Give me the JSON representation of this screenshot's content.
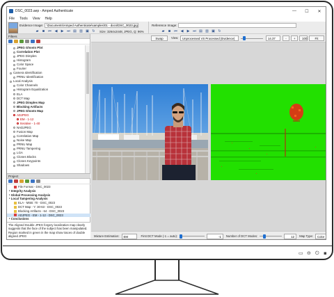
{
  "window": {
    "title": "DSC_0023.aep - Amped Authenticate",
    "minimize": "—",
    "maximize": "☐",
    "close": "✕"
  },
  "menu": [
    "File",
    "Tools",
    "View",
    "Help"
  ],
  "imagebar": {
    "evidence_label": "Evidence Image:",
    "evidence_path": "\\Documents\\Amped Authenticate\\samples\\01 - docs\\DSC_0023.jpg",
    "size_info": "Size: 3264x2448, JPEG, Q: 96%",
    "reference_label": "Reference Image:"
  },
  "filters": {
    "header": "Filters",
    "items": [
      {
        "label": "JPEG Ghosts Plot",
        "style": "bold",
        "indent": 1
      },
      {
        "label": "Correlation Plot",
        "style": "bold",
        "indent": 1
      },
      {
        "label": "JPEG Dimples",
        "style": "normal",
        "indent": 1
      },
      {
        "label": "Histogram",
        "style": "normal",
        "indent": 1
      },
      {
        "label": "Color Space",
        "style": "normal",
        "indent": 1
      },
      {
        "label": "Fourier",
        "style": "normal",
        "indent": 1
      },
      {
        "label": "Camera Identification",
        "style": "normal",
        "indent": 0
      },
      {
        "label": "PRNU Identification",
        "style": "normal",
        "indent": 1
      },
      {
        "label": "Local Analysis",
        "style": "normal",
        "indent": 0
      },
      {
        "label": "Color Channels",
        "style": "normal",
        "indent": 1
      },
      {
        "label": "Histogram Equalization",
        "style": "normal",
        "indent": 1
      },
      {
        "label": "ELA",
        "style": "normal",
        "indent": 1
      },
      {
        "label": "DCT Map",
        "style": "normal",
        "indent": 1
      },
      {
        "label": "JPEG Dimples Map",
        "style": "bold",
        "indent": 1
      },
      {
        "label": "Blocking Artifacts",
        "style": "bold",
        "indent": 1
      },
      {
        "label": "JPEG Ghosts Map",
        "style": "bold",
        "indent": 1
      },
      {
        "label": "ADJPEG",
        "style": "red",
        "indent": 1
      },
      {
        "label": "EM - 1-12",
        "style": "red",
        "indent": 2
      },
      {
        "label": "Iterative - 1-40",
        "style": "red",
        "indent": 2
      },
      {
        "label": "NADJPEG",
        "style": "normal",
        "indent": 1
      },
      {
        "label": "Fusion Map",
        "style": "normal",
        "indent": 1
      },
      {
        "label": "Correlation Map",
        "style": "normal",
        "indent": 1
      },
      {
        "label": "Noise Map",
        "style": "normal",
        "indent": 1
      },
      {
        "label": "PRNU Map",
        "style": "normal",
        "indent": 1
      },
      {
        "label": "PRNU Tampering",
        "style": "normal",
        "indent": 1
      },
      {
        "label": "LGA",
        "style": "normal",
        "indent": 1
      },
      {
        "label": "Clones Blocks",
        "style": "normal",
        "indent": 1
      },
      {
        "label": "Clones Keypoints",
        "style": "normal",
        "indent": 1
      },
      {
        "label": "Shadows",
        "style": "normal",
        "indent": 1
      }
    ]
  },
  "project": {
    "header": "Project",
    "items": [
      {
        "label": "File Format - DSC_0023",
        "indent": 1,
        "color": "#d94040"
      },
      {
        "label": "Integrity Analysis",
        "indent": 0,
        "bold": true
      },
      {
        "label": "Global Processing Analysis",
        "indent": 0,
        "bold": true
      },
      {
        "label": "Local Tampering Analysis",
        "indent": 0,
        "bold": true
      },
      {
        "label": "ELA - MSB: 70 - DSC_0023",
        "indent": 1,
        "color": "#e8c040"
      },
      {
        "label": "DCT Map - Y: 30-63 - DSC_0023",
        "indent": 1,
        "color": "#e8c040"
      },
      {
        "label": "Blocking Artifacts - 64 - DSC_0023",
        "indent": 1,
        "color": "#e8c040"
      },
      {
        "label": "ADJPEG - EM - 1-12 - DSC_0023",
        "indent": 1,
        "color": "#d94040",
        "selected": true
      },
      {
        "label": "Conclusions",
        "indent": 0,
        "bold": true
      }
    ]
  },
  "description": "The Aligned Double JPEG forgery localization map clearly suggests that the face of the subject has been manipulated. Region marked in green in the map show traces of double aligned JPEG",
  "viewtop": {
    "swap_label": "Swap",
    "view_label": "View:",
    "view_value": "Unprocessed VS Processed (Evidence)",
    "zoom_value": "14.37",
    "zoom_minus": "-",
    "zoom_plus": "+",
    "zoom_100": "100",
    "fit_label": "Fit",
    "zoom_level": 0.1
  },
  "bottombar": {
    "mixture_label": "Mixture Estimation:",
    "mixture_value": "EM",
    "first_dct_label": "First DCT Mode (-1 = auto):",
    "first_dct_value": "-1",
    "num_dct_label": "Number of DCT Modes:",
    "num_dct_value": "12",
    "map_type_label": "Map Type:",
    "map_type_value": "Color",
    "first_dct_level": 0.0,
    "num_dct_level": 0.18
  },
  "colors": {
    "accent": "#1f6fd0",
    "map_green": "#22e000",
    "tampered_red": "#d43c14"
  }
}
